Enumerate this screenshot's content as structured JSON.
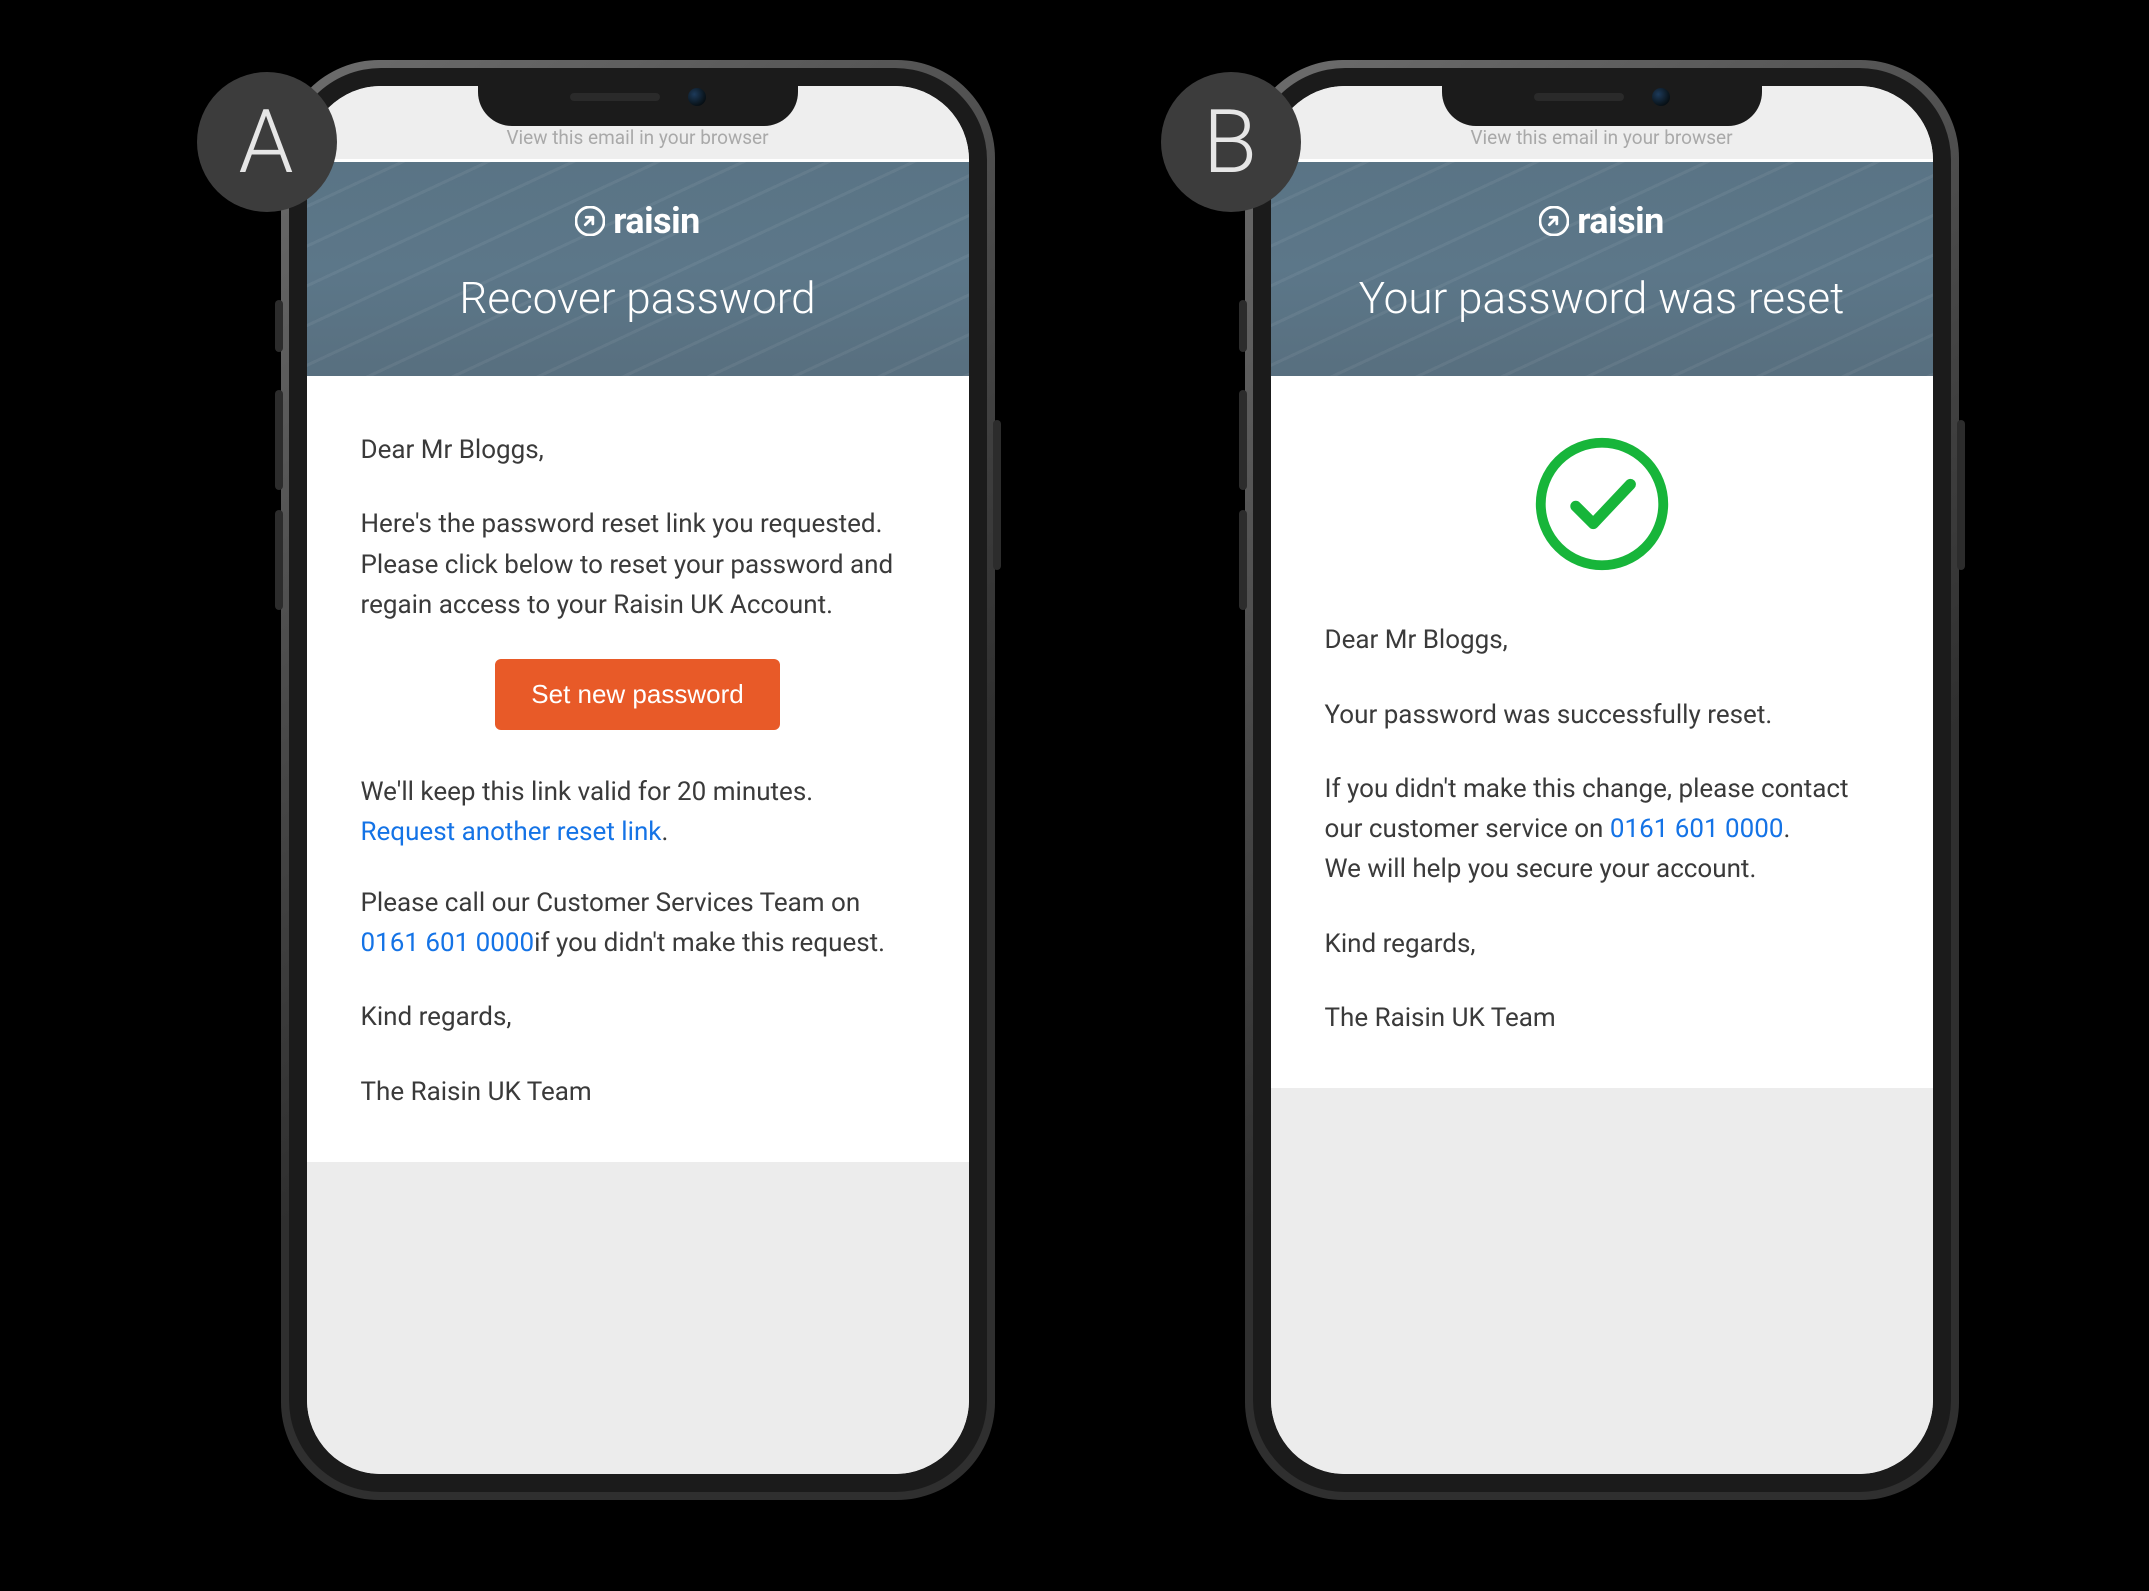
{
  "labels": {
    "A": "A",
    "B": "B"
  },
  "common": {
    "browser_hint": "View this email in your browser",
    "brand_name": "raisin",
    "signoff": "Kind regards,",
    "team": "The Raisin UK Team",
    "phone_number": "0161 601 0000"
  },
  "emailA": {
    "title": "Recover password",
    "greeting": "Dear Mr Bloggs,",
    "intro": "Here's the password reset link you requested. Please click below to reset your password and regain access to your Raisin UK Account.",
    "cta_label": "Set new password",
    "validity_text": "We'll keep this link valid for 20 minutes.",
    "request_link_text": "Request another reset link",
    "contact_pre": "Please call our Customer Services Team on ",
    "contact_post": "if you didn't make this request."
  },
  "emailB": {
    "title": "Your password was reset",
    "greeting": "Dear Mr Bloggs,",
    "body1": "Your password was successfully reset.",
    "body2_pre": "If you didn't make this change, please contact our customer service on ",
    "body2_post": ".",
    "body3": "We will help you secure your account."
  }
}
